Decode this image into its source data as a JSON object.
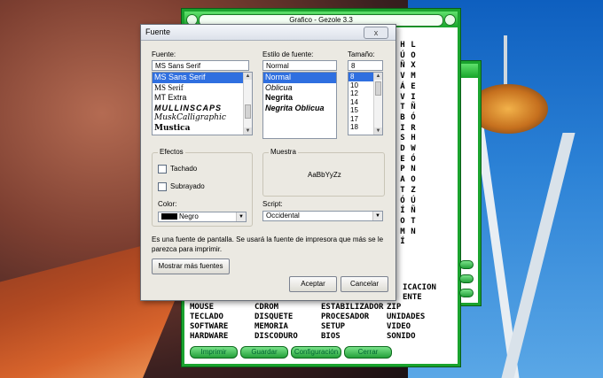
{
  "main_window": {
    "title": "Grafico - Gezole 3.3",
    "letters": [
      "H",
      "Ú",
      "Ñ",
      "V",
      "Á",
      "V",
      "T",
      "B",
      "I",
      "S",
      "D",
      "E",
      "P",
      "A",
      "T",
      "Ó",
      "Í",
      "O",
      "M",
      "Í",
      "L",
      "O",
      "X",
      "M",
      "E",
      "I",
      "Ñ",
      "Ó",
      "R",
      "H",
      "W",
      "Ó",
      "N",
      "O",
      "Z",
      "Ú",
      "Ñ",
      "T",
      "N"
    ],
    "words": [
      [
        "MOUSE",
        "CDROM",
        "ESTABILIZADOR",
        "ZIP"
      ],
      [
        "TECLADO",
        "DISQUETE",
        "PROCESADOR",
        "UNIDADES"
      ],
      [
        "SOFTWARE",
        "MEMORIA",
        "SETUP",
        "VIDEO"
      ],
      [
        "HARDWARE",
        "DISCODURO",
        "BIOS",
        "SONIDO"
      ]
    ],
    "word_extra_1": "ICACION",
    "word_extra_2": "ENTE",
    "buttons": [
      "Imprimir",
      "Guardar",
      "Configuración",
      "Cerrar"
    ]
  },
  "dialog": {
    "title": "Fuente",
    "close_label": "x",
    "font_label": "Fuente:",
    "font_value": "MS Sans Serif",
    "font_list": [
      "MS Sans Serif",
      "MS Serif",
      "MT Extra",
      "MULLINSCAPS",
      "MuskCalligraphic",
      "Mustica"
    ],
    "style_label": "Estilo de fuente:",
    "style_value": "Normal",
    "style_list": [
      "Normal",
      "Oblicua",
      "Negrita",
      "Negrita Oblicua"
    ],
    "size_label": "Tamaño:",
    "size_value": "8",
    "size_list": [
      "8",
      "10",
      "12",
      "14",
      "15",
      "17",
      "18"
    ],
    "effects_title": "Efectos",
    "strikeout_label": "Tachado",
    "underline_label": "Subrayado",
    "color_label": "Color:",
    "color_value": "Negro",
    "sample_title": "Muestra",
    "sample_text": "AaBbYyZz",
    "script_label": "Script:",
    "script_value": "Occidental",
    "info_text_1": "Es una fuente de pantalla. Se usará la fuente de impresora que más se le",
    "info_text_2": "parezca para imprimir.",
    "more_fonts": "Mostrar más fuentes",
    "ok": "Aceptar",
    "cancel": "Cancelar"
  },
  "colors": {
    "accent_green": "#1aa32e",
    "selection_blue": "#2f6fe0"
  }
}
